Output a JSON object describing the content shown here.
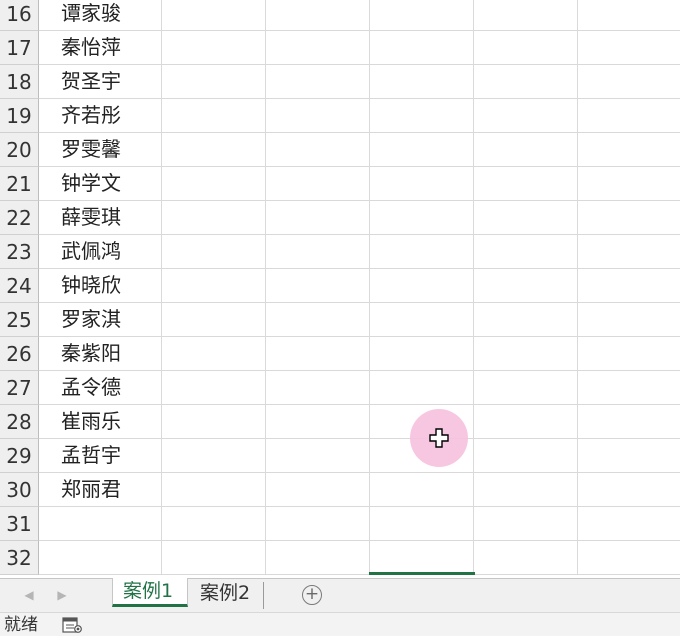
{
  "rows": [
    {
      "num": "16",
      "name": "谭家骏"
    },
    {
      "num": "17",
      "name": "秦怡萍"
    },
    {
      "num": "18",
      "name": "贺圣宇"
    },
    {
      "num": "19",
      "name": "齐若彤"
    },
    {
      "num": "20",
      "name": "罗雯馨"
    },
    {
      "num": "21",
      "name": "钟学文"
    },
    {
      "num": "22",
      "name": "薛雯琪"
    },
    {
      "num": "23",
      "name": "武佩鸿"
    },
    {
      "num": "24",
      "name": "钟晓欣"
    },
    {
      "num": "25",
      "name": "罗家淇"
    },
    {
      "num": "26",
      "name": "秦紫阳"
    },
    {
      "num": "27",
      "name": "孟令德"
    },
    {
      "num": "28",
      "name": "崔雨乐"
    },
    {
      "num": "29",
      "name": "孟哲宇"
    },
    {
      "num": "30",
      "name": "郑丽君"
    },
    {
      "num": "31",
      "name": ""
    },
    {
      "num": "32",
      "name": ""
    }
  ],
  "sheet_tabs": [
    {
      "label": "案例1",
      "active": true
    },
    {
      "label": "案例2",
      "active": false
    }
  ],
  "tab_nav": {
    "prev_icon": "triangle-left-icon",
    "next_icon": "triangle-right-icon"
  },
  "add_sheet_icon": "plus-circle-icon",
  "status": {
    "text": "就绪",
    "icon": "macro-record-icon"
  },
  "colors": {
    "accent": "#217346",
    "cursor_halo": "#f6c1df",
    "gridline": "#d9d9d9",
    "header_bg": "#efefef"
  }
}
